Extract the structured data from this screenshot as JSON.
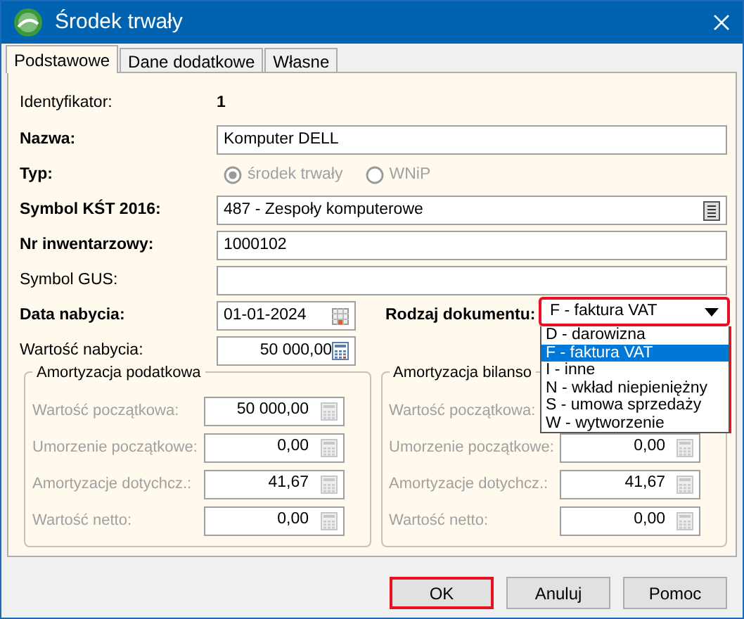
{
  "window": {
    "title": "Środek trwały"
  },
  "tabs": [
    {
      "label": "Podstawowe",
      "selected": true
    },
    {
      "label": "Dane dodatkowe",
      "selected": false
    },
    {
      "label": "Własne",
      "selected": false
    }
  ],
  "identifier": {
    "label": "Identyfikator:",
    "value": "1"
  },
  "name": {
    "label": "Nazwa:",
    "value": "Komputer DELL",
    "bold": true
  },
  "type": {
    "label": "Typ:",
    "disabled": true,
    "options": [
      {
        "label": "środek trwały",
        "selected": true
      },
      {
        "label": "WNiP",
        "selected": false
      }
    ]
  },
  "kst_symbol": {
    "label": "Symbol KŚT 2016:",
    "value": "487 - Zespoły komputerowe",
    "bold": true
  },
  "inventory_number": {
    "label": "Nr inwentarzowy:",
    "value": "1000102",
    "bold": true
  },
  "gus_symbol": {
    "label": "Symbol GUS:",
    "bold": false
  },
  "acquisition_date": {
    "label": "Data nabycia:",
    "value": "01-01-2024",
    "bold": true
  },
  "document_type": {
    "label": "Rodzaj dokumentu:",
    "value": "F - faktura VAT",
    "expanded": true,
    "options": [
      {
        "label": "D - darowizna",
        "selected": false
      },
      {
        "label": "F - faktura VAT",
        "selected": true
      },
      {
        "label": "I - inne",
        "selected": false
      },
      {
        "label": "N - wkład niepieniężny",
        "selected": false
      },
      {
        "label": "S - umowa sprzedaży",
        "selected": false
      },
      {
        "label": "W - wytworzenie",
        "selected": false
      }
    ]
  },
  "acquisition_value": {
    "label": "Wartość nabycia:",
    "value": "50 000,00",
    "bold": false
  },
  "groups": [
    {
      "title": "Amortyzacja podatkowa",
      "rows": [
        {
          "label": "Wartość początkowa:",
          "value": "50 000,00",
          "disabled": true
        },
        {
          "label": "Umorzenie początkowe:",
          "value": "0,00",
          "disabled": true
        },
        {
          "label": "Amortyzacje dotychcz.:",
          "value": "41,67",
          "disabled": true
        },
        {
          "label": "Wartość netto:",
          "value": "0,00",
          "disabled": true
        }
      ]
    },
    {
      "title": "Amortyzacja bilanso",
      "rows": [
        {
          "label": "Wartość początkowa:",
          "disabled": true
        },
        {
          "label": "Umorzenie początkowe:",
          "value": "0,00",
          "disabled": true
        },
        {
          "label": "Amortyzacje dotychcz.:",
          "value": "41,67",
          "disabled": true
        },
        {
          "label": "Wartość netto:",
          "value": "0,00",
          "disabled": true
        }
      ]
    }
  ],
  "buttons": [
    {
      "label": "OK",
      "default": true
    },
    {
      "label": "Anuluj",
      "default": false
    },
    {
      "label": "Pomoc",
      "default": false
    }
  ]
}
